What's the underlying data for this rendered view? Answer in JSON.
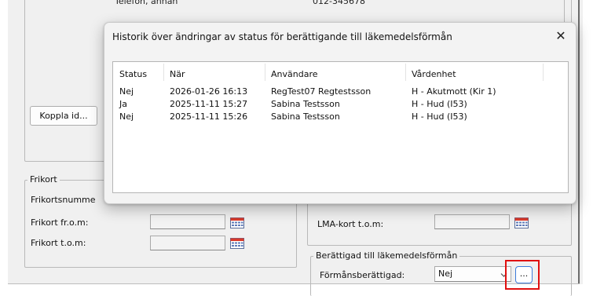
{
  "background_form": {
    "top_partial": {
      "label": "Telefon, annan",
      "value": "012-345678"
    },
    "koppla_button": "Koppla id...",
    "frikort_group": {
      "legend": "Frikort",
      "nummer_label": "Frikortsnumme",
      "from_label": "Frikort fr.o.m:",
      "tom_label": "Frikort t.o.m:"
    },
    "lma_group": {
      "tom_label": "LMA-kort t.o.m:"
    },
    "lakemedel_group": {
      "legend": "Berättigad till läkemedelsförmån",
      "formans_label": "Förmånsberättigad:",
      "formans_value": "Nej",
      "more_button": "..."
    }
  },
  "dialog": {
    "title": "Historik över ändringar av status för berättigande till läkemedelsförmån",
    "close_label": "✕",
    "columns": [
      "Status",
      "När",
      "Användare",
      "Vårdenhet"
    ],
    "rows": [
      {
        "status": "Nej",
        "nar": "2026-01-26 16:13",
        "anvandare": "RegTest07 Regtestsson",
        "vardenhet": "H - Akutmott (Kir 1)"
      },
      {
        "status": "Ja",
        "nar": "2025-11-11 15:27",
        "anvandare": "Sabina Testsson",
        "vardenhet": "H - Hud (I53)"
      },
      {
        "status": "Nej",
        "nar": "2025-11-11 15:26",
        "anvandare": "Sabina Testsson",
        "vardenhet": "H - Hud (I53)"
      }
    ]
  },
  "colors": {
    "highlight": "#e01010",
    "panel": "#f0f0f0"
  }
}
